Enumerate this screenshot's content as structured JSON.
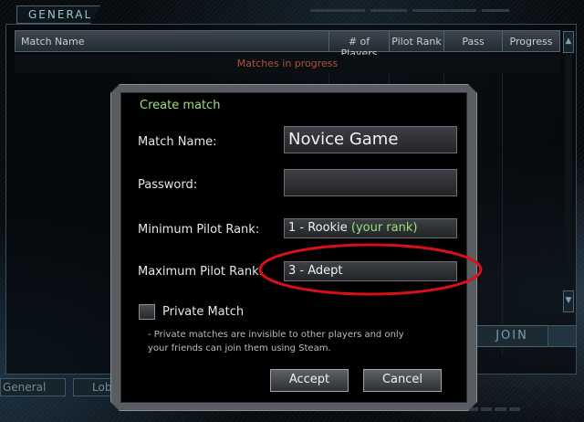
{
  "background": {
    "top_tab_label": "GENERAL",
    "table_headers": [
      "Match Name",
      "# of Players",
      "Pilot Rank",
      "Pass",
      "Progress"
    ],
    "matches_in_progress_label": "Matches in progress",
    "join_label": "JOIN",
    "bottom_tabs": [
      "General",
      "Lobb"
    ]
  },
  "dialog": {
    "title": "Create match",
    "match_name": {
      "label": "Match Name:",
      "value": "Novice Game"
    },
    "password": {
      "label": "Password:",
      "value": ""
    },
    "min_rank": {
      "label": "Minimum Pilot Rank:",
      "value": "1 - Rookie",
      "note": "(your rank)"
    },
    "max_rank": {
      "label": "Maximum Pilot Rank:",
      "value": "3 - Adept"
    },
    "private_match": {
      "label": "Private Match",
      "checked": false,
      "info": "- Private matches are invisible to other players and only your friends can join them using Steam."
    },
    "accept_label": "Accept",
    "cancel_label": "Cancel"
  },
  "colors": {
    "accent_green": "#9ee07a",
    "highlight_red": "#d8101a",
    "progress_text": "#b0503a"
  }
}
